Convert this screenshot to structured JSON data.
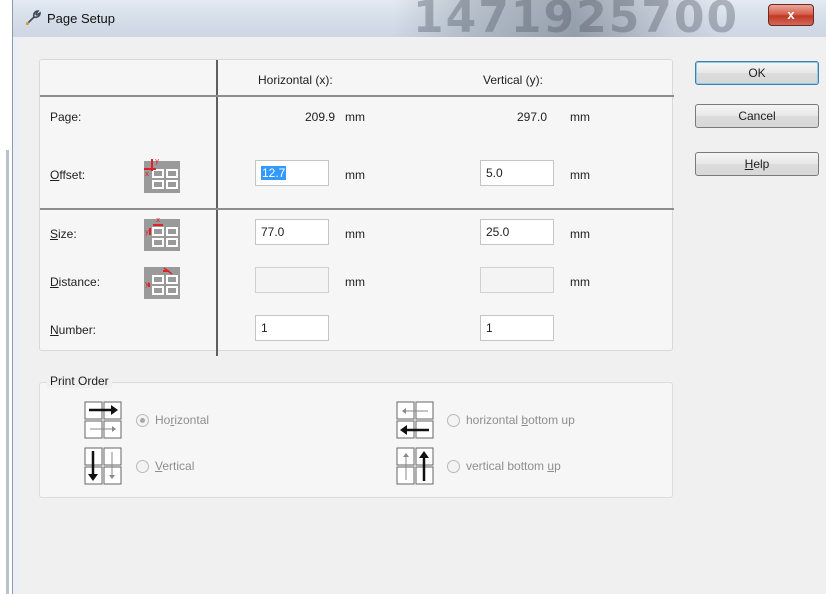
{
  "window": {
    "title": "Page Setup",
    "close_glyph": "x",
    "title_icon": "wrench-icon",
    "watermark": "1471925700"
  },
  "grid": {
    "col_horizontal": "Horizontal (x):",
    "col_vertical": "Vertical (y):",
    "page": {
      "label": "Page:",
      "x_value": "209.9",
      "x_unit": "mm",
      "y_value": "297.0",
      "y_unit": "mm"
    },
    "offset": {
      "label_prefix": "",
      "label_mnemonic": "O",
      "label_rest": "ffset:",
      "x_value": "12.7",
      "x_unit": "mm",
      "y_value": "5.0",
      "y_unit": "mm"
    },
    "size": {
      "label_mnemonic": "S",
      "label_rest": "ize:",
      "x_value": "77.0",
      "x_unit": "mm",
      "y_value": "25.0",
      "y_unit": "mm"
    },
    "distance": {
      "label_mnemonic": "D",
      "label_rest": "istance:",
      "x_value": "",
      "x_unit": "mm",
      "y_value": "",
      "y_unit": "mm"
    },
    "number": {
      "label_mnemonic": "N",
      "label_rest": "umber:",
      "x_value": "1",
      "y_value": "1"
    }
  },
  "print_order": {
    "title": "Print Order",
    "options": [
      {
        "pre": "Ho",
        "mnemonic": "r",
        "post": "izontal",
        "checked": true
      },
      {
        "pre": "",
        "mnemonic": "V",
        "post": "ertical",
        "checked": false
      },
      {
        "pre": "horizontal ",
        "mnemonic": "b",
        "post": "ottom up",
        "checked": false
      },
      {
        "pre": "vertical bottom ",
        "mnemonic": "u",
        "post": "p",
        "checked": false
      }
    ]
  },
  "buttons": {
    "ok": "OK",
    "cancel": "Cancel",
    "help_mnemonic": "H",
    "help_rest": "elp"
  },
  "colors": {
    "selection": "#3399ff",
    "close_button": "#c13a24",
    "dimension_marker": "#e0202c"
  }
}
